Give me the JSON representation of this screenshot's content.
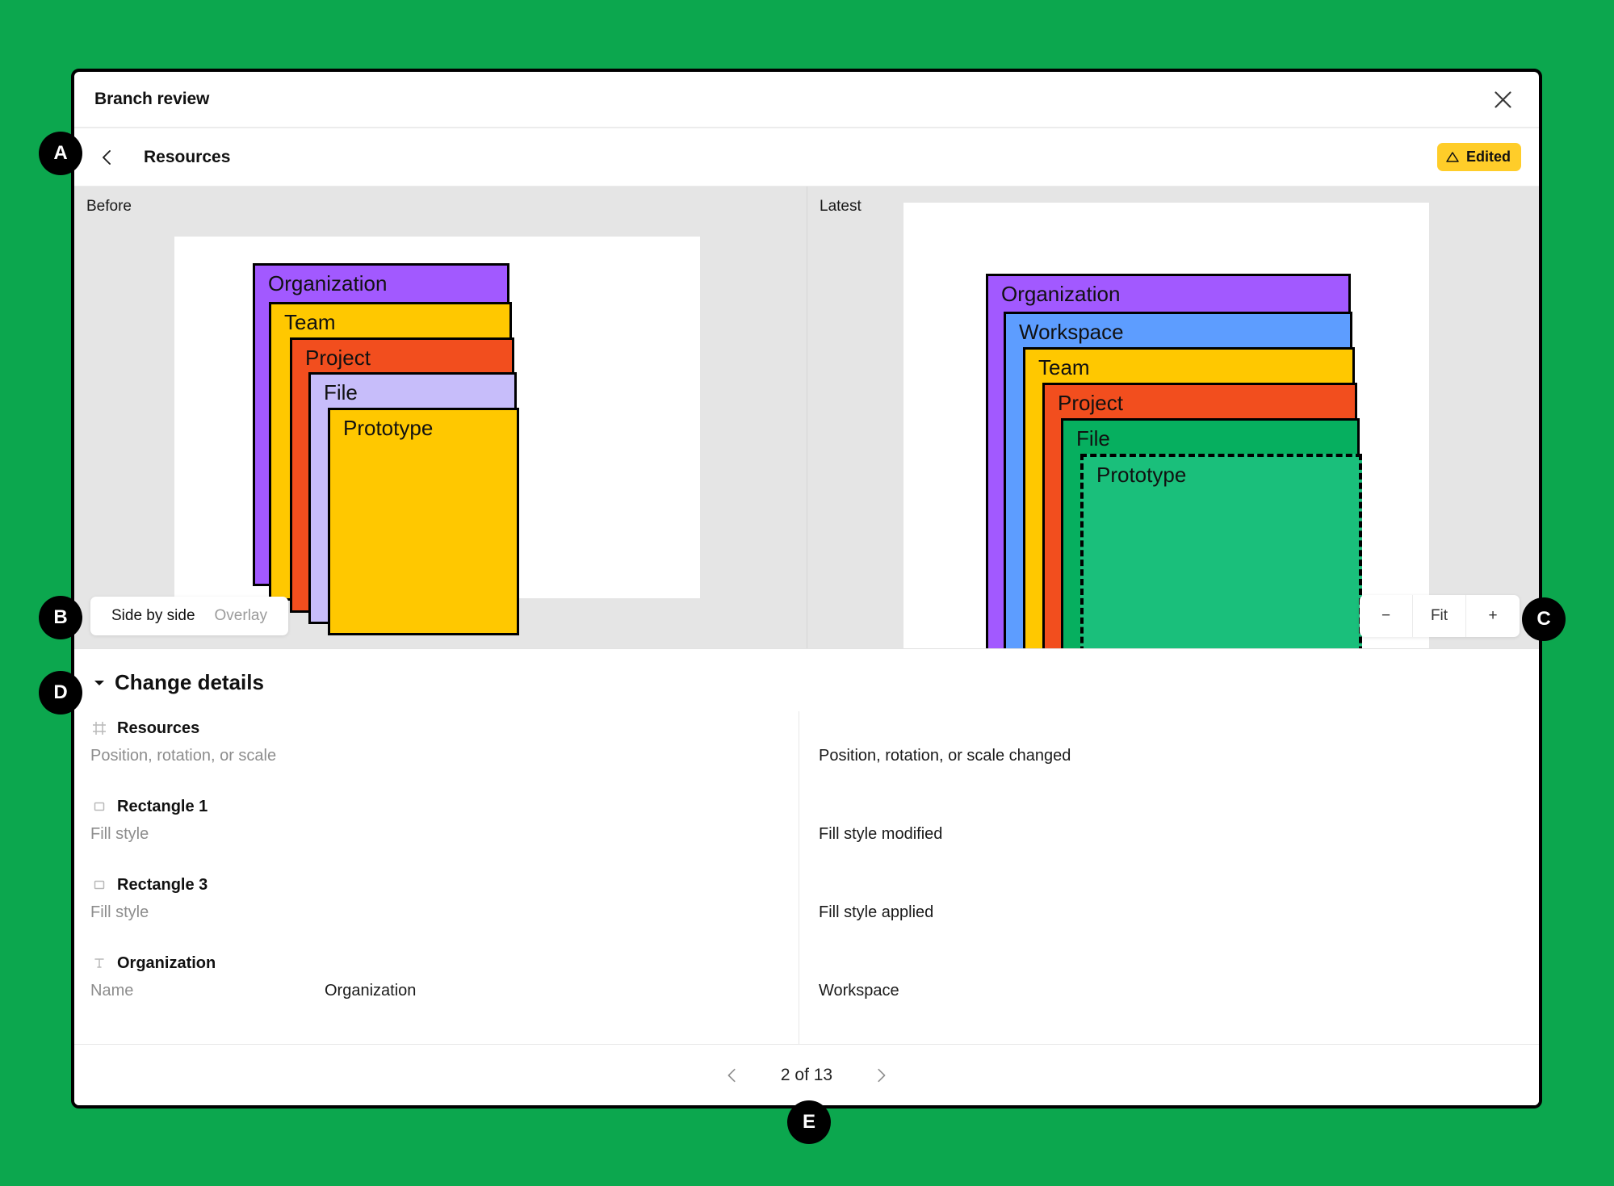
{
  "window": {
    "title": "Branch review",
    "close_icon": "close-icon"
  },
  "subheader": {
    "back_icon": "chevron-left-icon",
    "title": "Resources",
    "badge": {
      "label": "Edited",
      "icon": "warning-triangle-icon",
      "color": "#FFCD29"
    }
  },
  "compare": {
    "before_label": "Before",
    "latest_label": "Latest",
    "view_modes": [
      {
        "label": "Side by side",
        "active": true
      },
      {
        "label": "Overlay",
        "active": false
      }
    ],
    "zoom_controls": [
      {
        "label": "−",
        "name": "zoom-out-button"
      },
      {
        "label": "Fit",
        "name": "zoom-fit-button"
      },
      {
        "label": "+",
        "name": "zoom-in-button"
      }
    ],
    "before_diagram": {
      "boxes": [
        {
          "label": "Organization",
          "color": "#A259FF"
        },
        {
          "label": "Team",
          "color": "#FFC800"
        },
        {
          "label": "Project",
          "color": "#F24E1E"
        },
        {
          "label": "File",
          "color": "#C7BDFA"
        },
        {
          "label": "Prototype",
          "color": "#FFC800"
        }
      ]
    },
    "latest_diagram": {
      "boxes": [
        {
          "label": "Organization",
          "color": "#A259FF"
        },
        {
          "label": "Workspace",
          "color": "#5D9DFF"
        },
        {
          "label": "Team",
          "color": "#FFC800"
        },
        {
          "label": "Project",
          "color": "#F24E1E"
        },
        {
          "label": "File",
          "color": "#06AF5F"
        },
        {
          "label": "Prototype",
          "color": "#1ABF7B",
          "dashed": true
        }
      ]
    }
  },
  "change_details": {
    "title": "Change details",
    "expanded": true,
    "rows": [
      {
        "icon": "frame-icon",
        "name": "Resources",
        "property": "Position, rotation, or scale",
        "before_value": "",
        "after_value": "Position, rotation, or scale changed"
      },
      {
        "icon": "rectangle-icon",
        "name": "Rectangle 1",
        "property": "Fill style",
        "before_value": "",
        "after_value": "Fill style modified"
      },
      {
        "icon": "rectangle-icon",
        "name": "Rectangle 3",
        "property": "Fill style",
        "before_value": "",
        "after_value": "Fill style applied"
      },
      {
        "icon": "text-icon",
        "name": "Organization",
        "property": "Name",
        "before_value": "Organization",
        "after_value": "Workspace"
      }
    ]
  },
  "pager": {
    "prev_icon": "chevron-left-icon",
    "next_icon": "chevron-right-icon",
    "label": "2 of 13"
  },
  "annotations": [
    {
      "letter": "A"
    },
    {
      "letter": "B"
    },
    {
      "letter": "C"
    },
    {
      "letter": "D"
    },
    {
      "letter": "E"
    }
  ]
}
